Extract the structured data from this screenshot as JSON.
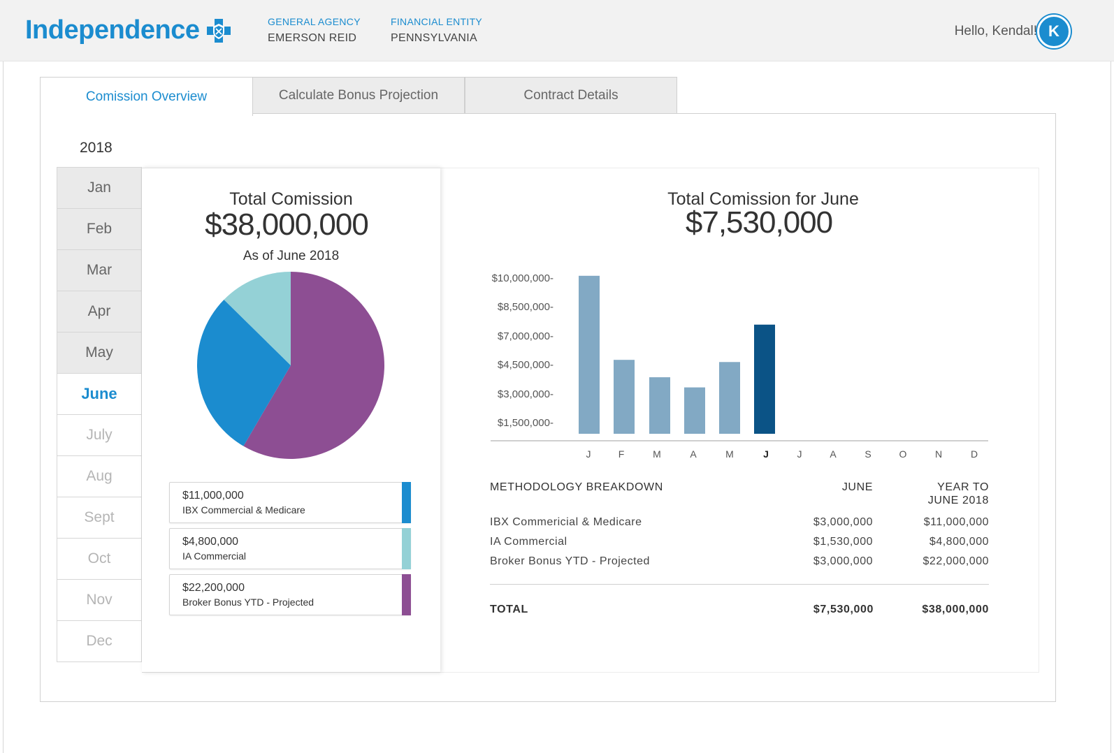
{
  "header": {
    "logo_text": "Independence",
    "general_agency_label": "GENERAL AGENCY",
    "general_agency_value": "EMERSON REID",
    "financial_entity_label": "FINANCIAL ENTITY",
    "financial_entity_value": "PENNSYLVANIA",
    "greeting": "Hello, Kendal!",
    "avatar_initial": "K"
  },
  "tabs": [
    {
      "label": "Comission Overview",
      "active": true
    },
    {
      "label": "Calculate Bonus Projection",
      "active": false
    },
    {
      "label": "Contract Details",
      "active": false
    }
  ],
  "year": "2018",
  "months": [
    {
      "label": "Jan",
      "state": "past"
    },
    {
      "label": "Feb",
      "state": "past"
    },
    {
      "label": "Mar",
      "state": "past"
    },
    {
      "label": "Apr",
      "state": "past"
    },
    {
      "label": "May",
      "state": "past"
    },
    {
      "label": "June",
      "state": "current"
    },
    {
      "label": "July",
      "state": "future"
    },
    {
      "label": "Aug",
      "state": "future"
    },
    {
      "label": "Sept",
      "state": "future"
    },
    {
      "label": "Oct",
      "state": "future"
    },
    {
      "label": "Nov",
      "state": "future"
    },
    {
      "label": "Dec",
      "state": "future"
    }
  ],
  "total_card": {
    "title": "Total Comission",
    "amount": "$38,000,000",
    "as_of": "As of June 2018"
  },
  "legend": [
    {
      "value": "$11,000,000",
      "name": "IBX Commercial & Medicare",
      "color": "#1b8ccf"
    },
    {
      "value": "$4,800,000",
      "name": "IA Commercial",
      "color": "#94d1d6"
    },
    {
      "value": "$22,200,000",
      "name": "Broker Bonus YTD - Projected",
      "color": "#8d4e93"
    }
  ],
  "month_card": {
    "title": "Total Comission for June",
    "amount": "$7,530,000"
  },
  "y_ticks": [
    "$10,000,000-",
    "$8,500,000-",
    "$7,000,000-",
    "$4,500,000-",
    "$3,000,000-",
    "$1,500,000-"
  ],
  "x_ticks": [
    "J",
    "F",
    "M",
    "A",
    "M",
    "J",
    "J",
    "A",
    "S",
    "O",
    "N",
    "D"
  ],
  "methodology": {
    "heading": "METHODOLOGY BREAKDOWN",
    "col_june": "JUNE",
    "col_ytd_line1": "YEAR TO",
    "col_ytd_line2": "JUNE 2018",
    "rows": [
      {
        "name": "IBX Commericial & Medicare",
        "june": "$3,000,000",
        "ytd": "$11,000,000"
      },
      {
        "name": "IA Commercial",
        "june": "$1,530,000",
        "ytd": "$4,800,000"
      },
      {
        "name": "Broker Bonus YTD - Projected",
        "june": "$3,000,000",
        "ytd": "$22,000,000"
      }
    ],
    "total_label": "TOTAL",
    "total_june": "$7,530,000",
    "total_ytd": "$38,000,000"
  },
  "chart_data": [
    {
      "type": "pie",
      "labels": [
        "IBX Commercial & Medicare",
        "IA Commercial",
        "Broker Bonus YTD - Projected"
      ],
      "values": [
        11000000,
        4800000,
        22200000
      ],
      "colors": [
        "#1b8ccf",
        "#94d1d6",
        "#8d4e93"
      ]
    },
    {
      "type": "bar",
      "categories": [
        "J",
        "F",
        "M",
        "A",
        "M",
        "J",
        "J",
        "A",
        "S",
        "O",
        "N",
        "D"
      ],
      "values": [
        10900000,
        5100000,
        3900000,
        3200000,
        4950000,
        7530000,
        null,
        null,
        null,
        null,
        null,
        null
      ],
      "highlight_index": 5,
      "colors": {
        "default": "#82a9c4",
        "highlight": "#0b5386"
      },
      "y_tick_labels": [
        "$10,000,000-",
        "$8,500,000-",
        "$7,000,000-",
        "$4,500,000-",
        "$3,000,000-",
        "$1,500,000-"
      ],
      "grid": false
    }
  ]
}
